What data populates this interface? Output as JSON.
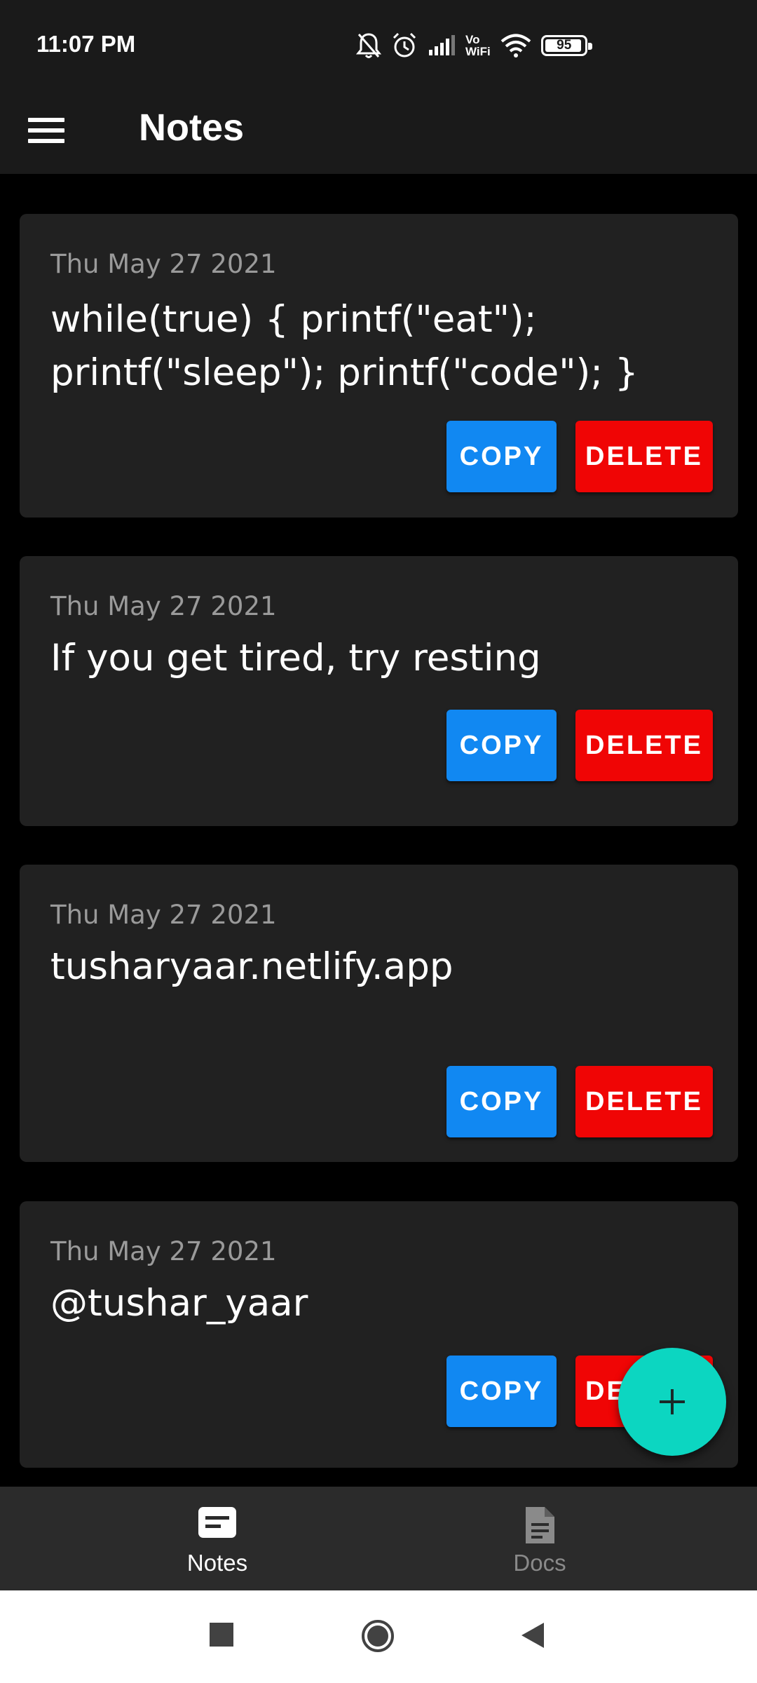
{
  "status_bar": {
    "time": "11:07 PM",
    "icons": [
      "bell-off-icon",
      "alarm-icon",
      "signal-icon",
      "vowifi-icon",
      "wifi-icon",
      "battery-icon"
    ],
    "volte_line1": "Vo",
    "volte_line2": "WiFi",
    "battery_level": "95"
  },
  "app_bar": {
    "menu_icon": "menu-icon",
    "title": "Notes"
  },
  "notes": [
    {
      "date": "Thu May 27 2021",
      "text": "while(true) { printf(\"eat\"); printf(\"sleep\"); printf(\"code\"); }",
      "copy_label": "COPY",
      "delete_label": "DELETE"
    },
    {
      "date": "Thu May 27 2021",
      "text": "If you get tired, try resting",
      "copy_label": "COPY",
      "delete_label": "DELETE"
    },
    {
      "date": "Thu May 27 2021",
      "text": "tusharyaar.netlify.app",
      "copy_label": "COPY",
      "delete_label": "DELETE"
    },
    {
      "date": "Thu May 27 2021",
      "text": "@tushar_yaar",
      "copy_label": "COPY",
      "delete_label": "DELETE"
    }
  ],
  "fab": {
    "icon": "plus-icon"
  },
  "bottom_nav": {
    "items": [
      {
        "label": "Notes",
        "icon": "notes-icon",
        "active": true
      },
      {
        "label": "Docs",
        "icon": "document-icon",
        "active": false
      }
    ]
  },
  "colors": {
    "background": "#000000",
    "card": "#212121",
    "copy_button": "#1188f2",
    "delete_button": "#f00505",
    "fab": "#0cd6c1",
    "nav_active": "#ffffff",
    "nav_inactive": "#8a8a8a"
  },
  "system_nav": {
    "icons": [
      "recents-square-icon",
      "home-circle-icon",
      "back-triangle-icon"
    ]
  }
}
